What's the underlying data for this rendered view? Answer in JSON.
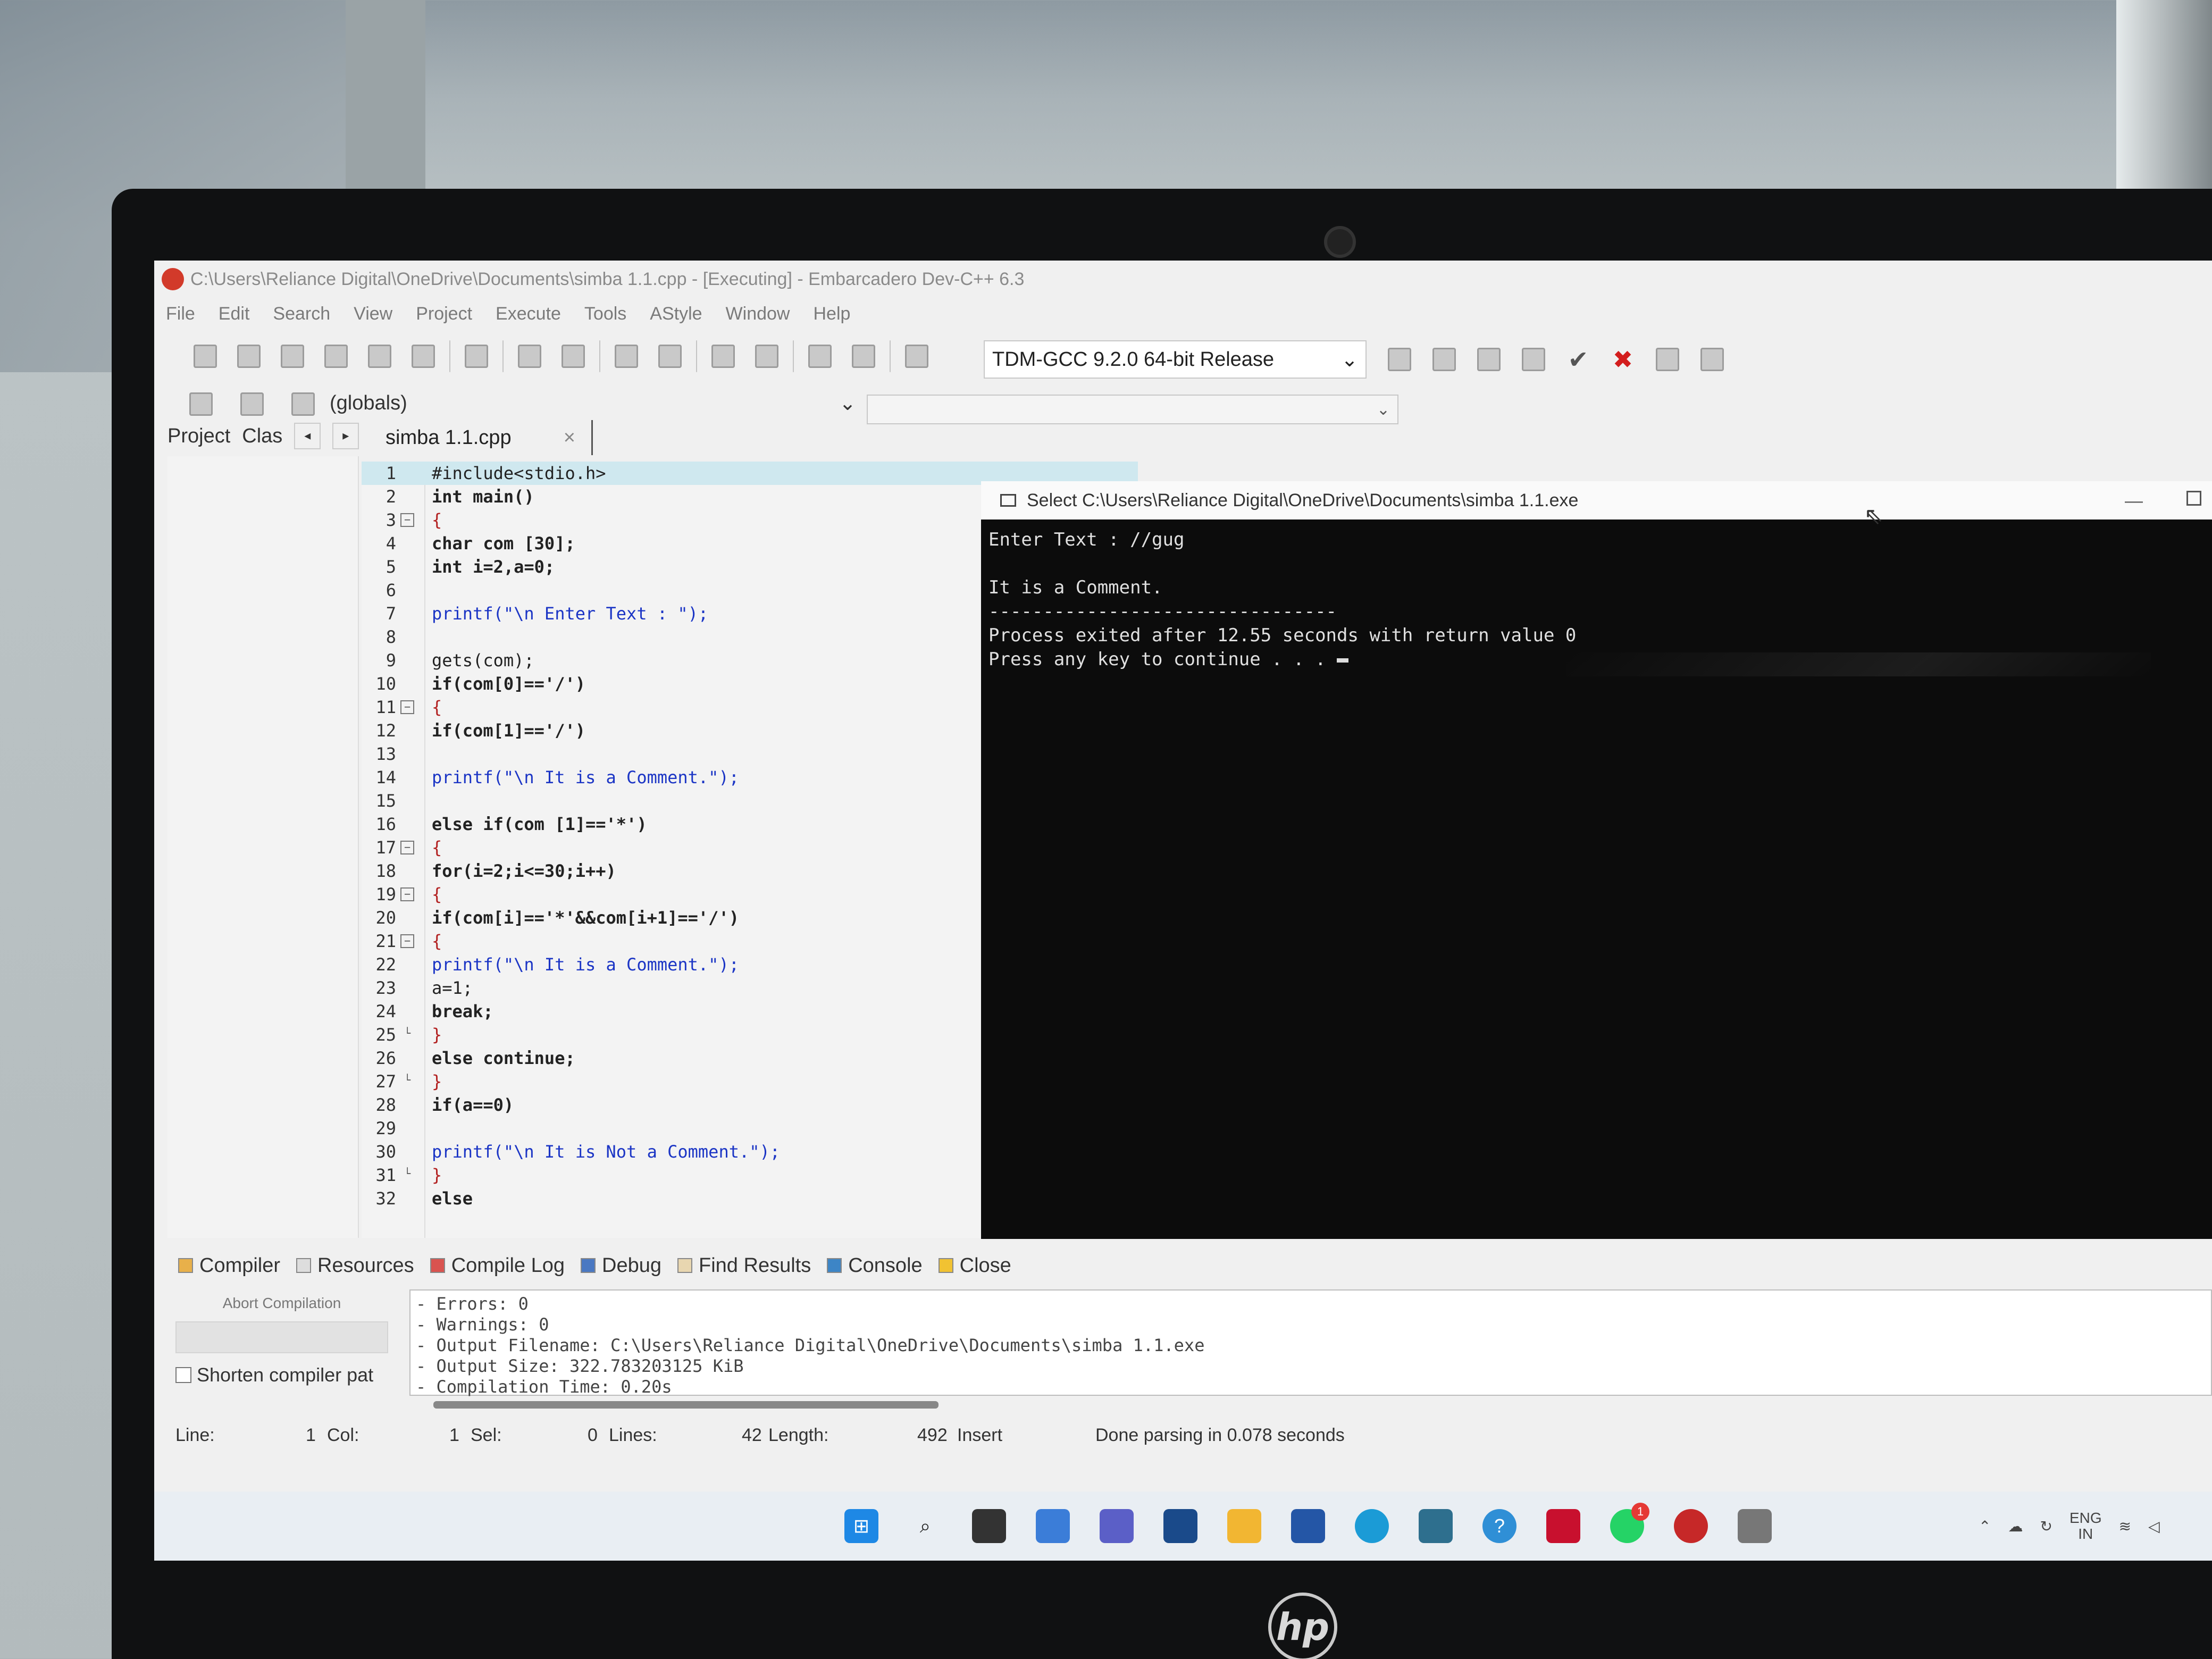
{
  "window": {
    "title": "C:\\Users\\Reliance Digital\\OneDrive\\Documents\\simba 1.1.cpp - [Executing] - Embarcadero Dev-C++ 6.3"
  },
  "menu": [
    "File",
    "Edit",
    "Search",
    "View",
    "Project",
    "Execute",
    "Tools",
    "AStyle",
    "Window",
    "Help"
  ],
  "toolbar": {
    "compiler": "TDM-GCC 9.2.0 64-bit Release",
    "scope": "(globals)"
  },
  "left_tabs": {
    "project": "Project",
    "classes": "Clas"
  },
  "file_tab": {
    "name": "simba 1.1.cpp",
    "close": "×"
  },
  "code_lines": [
    "#include<stdio.h>",
    "int main()",
    "{",
    "char com [30];",
    "int i=2,a=0;",
    "",
    "printf(\"\\n Enter Text : \");",
    "",
    "gets(com);",
    "if(com[0]=='/')",
    "{",
    "if(com[1]=='/')",
    "",
    "printf(\"\\n It is a Comment.\");",
    "",
    "else if(com [1]=='*')",
    "{",
    "for(i=2;i<=30;i++)",
    "{",
    "if(com[i]=='*'&&com[i+1]=='/')",
    "{",
    "printf(\"\\n It is a Comment.\");",
    "a=1;",
    "break;",
    "}",
    "else continue;",
    "}",
    "if(a==0)",
    "",
    "printf(\"\\n It is Not a Comment.\");",
    "}",
    "else"
  ],
  "console": {
    "title": "Select C:\\Users\\Reliance Digital\\OneDrive\\Documents\\simba 1.1.exe",
    "lines": [
      "Enter Text : //gug",
      "",
      "It is a Comment.",
      "--------------------------------",
      "Process exited after 12.55 seconds with return value 0",
      "Press any key to continue . . . "
    ]
  },
  "bottom_tabs": [
    "Compiler",
    "Resources",
    "Compile Log",
    "Debug",
    "Find Results",
    "Console",
    "Close"
  ],
  "compile_panel": {
    "abort": "Abort Compilation",
    "shorten": "Shorten compiler pat",
    "log": [
      "- Errors: 0",
      "- Warnings: 0",
      "- Output Filename: C:\\Users\\Reliance Digital\\OneDrive\\Documents\\simba 1.1.exe",
      "- Output Size: 322.783203125 KiB",
      "- Compilation Time: 0.20s"
    ]
  },
  "status": {
    "line_label": "Line:",
    "line": "1",
    "col_label": "Col:",
    "col": "1",
    "sel_label": "Sel:",
    "sel": "0",
    "lines_label": "Lines:",
    "lines": "42",
    "length_label": "Length:",
    "length": "492",
    "mode": "Insert",
    "message": "Done parsing in 0.078 seconds"
  },
  "taskbar": {
    "icons": [
      "windows-start",
      "search",
      "task-view",
      "widgets",
      "teams-chat",
      "prime-video",
      "file-explorer",
      "microsoft-store",
      "edge",
      "app-circle",
      "help",
      "mcafee",
      "whatsapp",
      "dev-cpp",
      "terminal"
    ],
    "whatsapp_badge": "1",
    "lang": "ENG",
    "region": "IN"
  },
  "colors": {
    "console_bg": "#0c0c0c",
    "keyword": "#111111",
    "string": "#1b35c5",
    "highlight": "#cfe8ef"
  },
  "branding": "hp"
}
